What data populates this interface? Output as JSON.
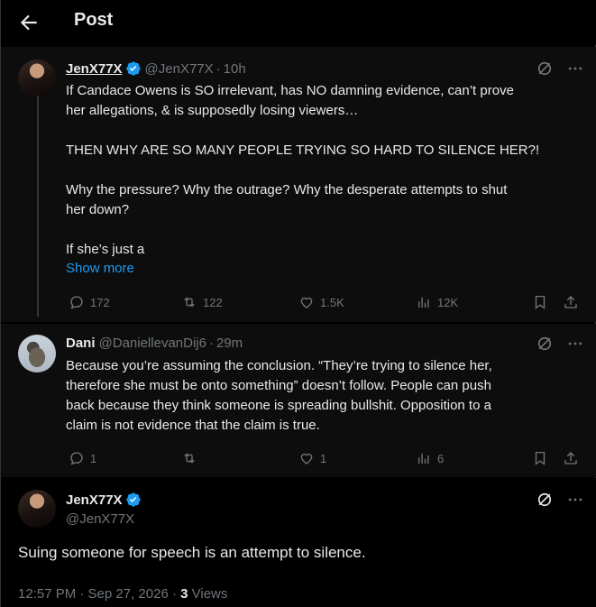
{
  "header": {
    "title": "Post"
  },
  "tweets": [
    {
      "name": "JenX77X",
      "handle": "@JenX77X",
      "time": "10h",
      "lines": [
        "If Candace Owens is SO irrelevant, has NO damning evidence, can’t prove",
        "her allegations, & is supposedly losing viewers…",
        "",
        "THEN WHY ARE SO MANY PEOPLE TRYING SO HARD TO SILENCE HER?!",
        "",
        "Why the pressure? Why the outrage? Why the desperate attempts to shut",
        "her down?",
        "",
        "If she’s just a"
      ],
      "show_more": "Show more",
      "replies": "172",
      "reposts": "122",
      "likes": "1.5K",
      "views": "12K"
    },
    {
      "name": "Dani",
      "handle": "@DaniellevanDij6",
      "time": "29m",
      "lines": [
        "Because you’re assuming the conclusion. “They’re trying to silence her,",
        "therefore she must be onto something” doesn’t follow. People can push",
        "back because they think someone is spreading bullshit. Opposition to a",
        "claim is not evidence that the claim is true."
      ],
      "replies": "1",
      "reposts": "",
      "likes": "1",
      "views": "6"
    }
  ],
  "main_post": {
    "name": "JenX77X",
    "handle": "@JenX77X",
    "text": "Suing someone for speech is an attempt to silence.",
    "timestamp": "12:57 PM · Sep 27, 2026 · ",
    "views_count": "3",
    "views_label": " Views"
  },
  "colors": {
    "accent": "#1d9bf0",
    "muted": "#71767b",
    "text": "#e7e9ea",
    "background": "#000000"
  }
}
